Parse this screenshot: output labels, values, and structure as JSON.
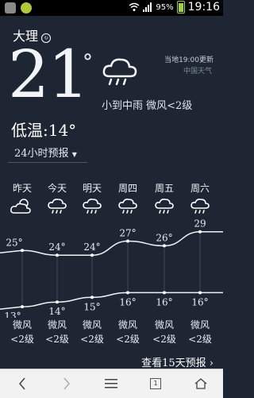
{
  "status_bar": {
    "battery_pct": "95%",
    "time": "19:16"
  },
  "header": {
    "city": "大理",
    "temperature": "21",
    "degree_symbol": "°",
    "update_time": "当地19:00更新",
    "source": "中国天气",
    "condition": "小到中雨 微风<2级",
    "low_temp": "低温:14°",
    "forecast_24h": "24小时预报",
    "city_icon_name": "location-badge-icon",
    "weather_icon_name": "rain-cloud-icon"
  },
  "forecast": {
    "days": [
      {
        "label": "昨天",
        "icon": "partly-cloudy-icon",
        "high": "25°",
        "low": "13°",
        "wind": "微风",
        "wind_level": "<2级"
      },
      {
        "label": "今天",
        "icon": "rain-cloud-icon",
        "high": "24°",
        "low": "14°",
        "wind": "微风",
        "wind_level": "<2级"
      },
      {
        "label": "明天",
        "icon": "rain-cloud-icon",
        "high": "24°",
        "low": "15°",
        "wind": "微风",
        "wind_level": "<2级"
      },
      {
        "label": "周四",
        "icon": "rain-cloud-icon",
        "high": "27°",
        "low": "16°",
        "wind": "微风",
        "wind_level": "<2级"
      },
      {
        "label": "周五",
        "icon": "rain-cloud-icon",
        "high": "26°",
        "low": "16°",
        "wind": "微风",
        "wind_level": "<2级"
      },
      {
        "label": "周六",
        "icon": "rain-cloud-icon",
        "high": "29",
        "low": "16°",
        "wind": "微风",
        "wind_level": "<2级"
      }
    ],
    "more_link": "查看15天预报 ›"
  },
  "chart_data": {
    "type": "line",
    "categories": [
      "昨天",
      "今天",
      "明天",
      "周四",
      "周五",
      "周六"
    ],
    "series": [
      {
        "values": [
          25,
          24,
          24,
          27,
          26,
          29
        ]
      },
      {
        "values": [
          13,
          14,
          15,
          16,
          16,
          16
        ]
      }
    ]
  },
  "nav_bar": {
    "tab_count": "1"
  }
}
